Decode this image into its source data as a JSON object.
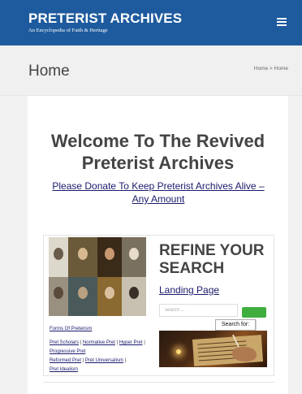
{
  "header": {
    "site_title": "PRETERIST ARCHIVES",
    "tagline": "An Encyclopedia of Faith & Heritage",
    "menu_icon": "hamburger-icon",
    "background": "#1e5b9e"
  },
  "page": {
    "title": "Home",
    "breadcrumb": {
      "home": "Home",
      "separator": ">",
      "current": "Home"
    }
  },
  "main": {
    "welcome": "Welcome To The Revived Preterist Archives",
    "donate_link": "Please Donate To Keep Preterist Archives Alive – Any Amount"
  },
  "search_panel": {
    "heading": "REFINE YOUR SEARCH",
    "landing_link": "Landing Page",
    "search_placeholder": "search ...",
    "search_tooltip": "Search for:",
    "search_button_color": "#3fae3f",
    "links": {
      "forms": "Forms Of Preterism",
      "row1": [
        "Pret Scholars",
        "Normative Pret",
        "Hyper Pret",
        "Progressive Pret"
      ],
      "row2": [
        "Reformed Pret",
        "Pret Universalism",
        "Pret Idealism"
      ],
      "separator": "|"
    }
  }
}
